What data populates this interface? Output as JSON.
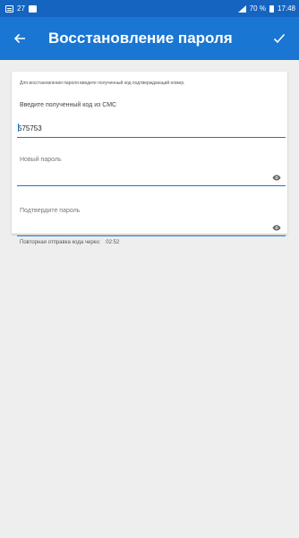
{
  "status_bar": {
    "left_text": "27",
    "battery_text": "70 %",
    "time": "17:48",
    "icons": [
      "message-icon",
      "notification-icon",
      "signal-icon",
      "battery-icon"
    ]
  },
  "toolbar": {
    "back_icon": "arrow-left-icon",
    "title": "Восстановление пароля",
    "done_icon": "check-icon"
  },
  "form": {
    "hint": "Для восстановления пароля введите полученный код подтверждающий номер.",
    "code_label": "Введите полученный код из СМС",
    "code_value": "575753",
    "new_password_label": "Новый пароль",
    "new_password_value": "",
    "confirm_password_label": "Подтвердите пароль",
    "confirm_password_value": "",
    "resend_label": "Повторная отправка кода через:",
    "resend_time": "02:52"
  },
  "colors": {
    "primary": "#1976d2",
    "status_bar": "#1565c0",
    "background": "#eeeeee",
    "card": "#ffffff"
  }
}
